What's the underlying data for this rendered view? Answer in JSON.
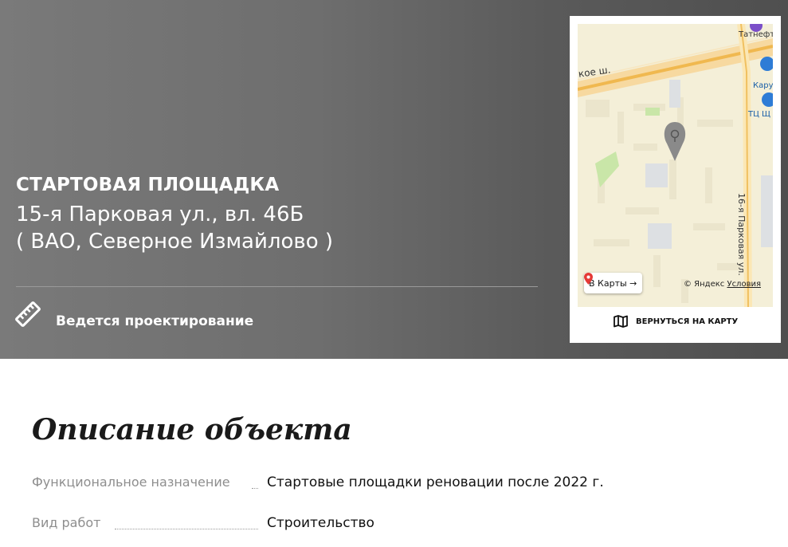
{
  "hero": {
    "title": "СТАРТОВАЯ ПЛОЩАДКА",
    "address": "15-я Парковая ул., вл. 46Б",
    "district": "( ВАО, Северное Измайлово )",
    "status": "Ведется проектирование",
    "status_icon": "ruler-icon"
  },
  "map": {
    "road_label": "кое ш.",
    "street_label": "16-я Парковая ул.",
    "poi_1": "Татнефть",
    "poi_2": "Кару",
    "poi_3": "ТЦ Щ",
    "open_button": "В Карты →",
    "copyright": "© Яндекс",
    "terms": "Условия",
    "return_label": "ВЕРНУТЬСЯ НА КАРТУ",
    "return_icon": "map-icon",
    "pin_icon": "map-pin-icon",
    "colors": {
      "background": "#f4efd8",
      "road": "#f5c97a",
      "park": "#c9e6a8",
      "pin": "#8a8a8a"
    }
  },
  "description": {
    "title": "Описание объекта",
    "rows": [
      {
        "label": "Функциональное назначение",
        "value": "Стартовые площадки реновации после 2022 г."
      },
      {
        "label": "Вид работ",
        "value": "Строительство"
      }
    ]
  }
}
